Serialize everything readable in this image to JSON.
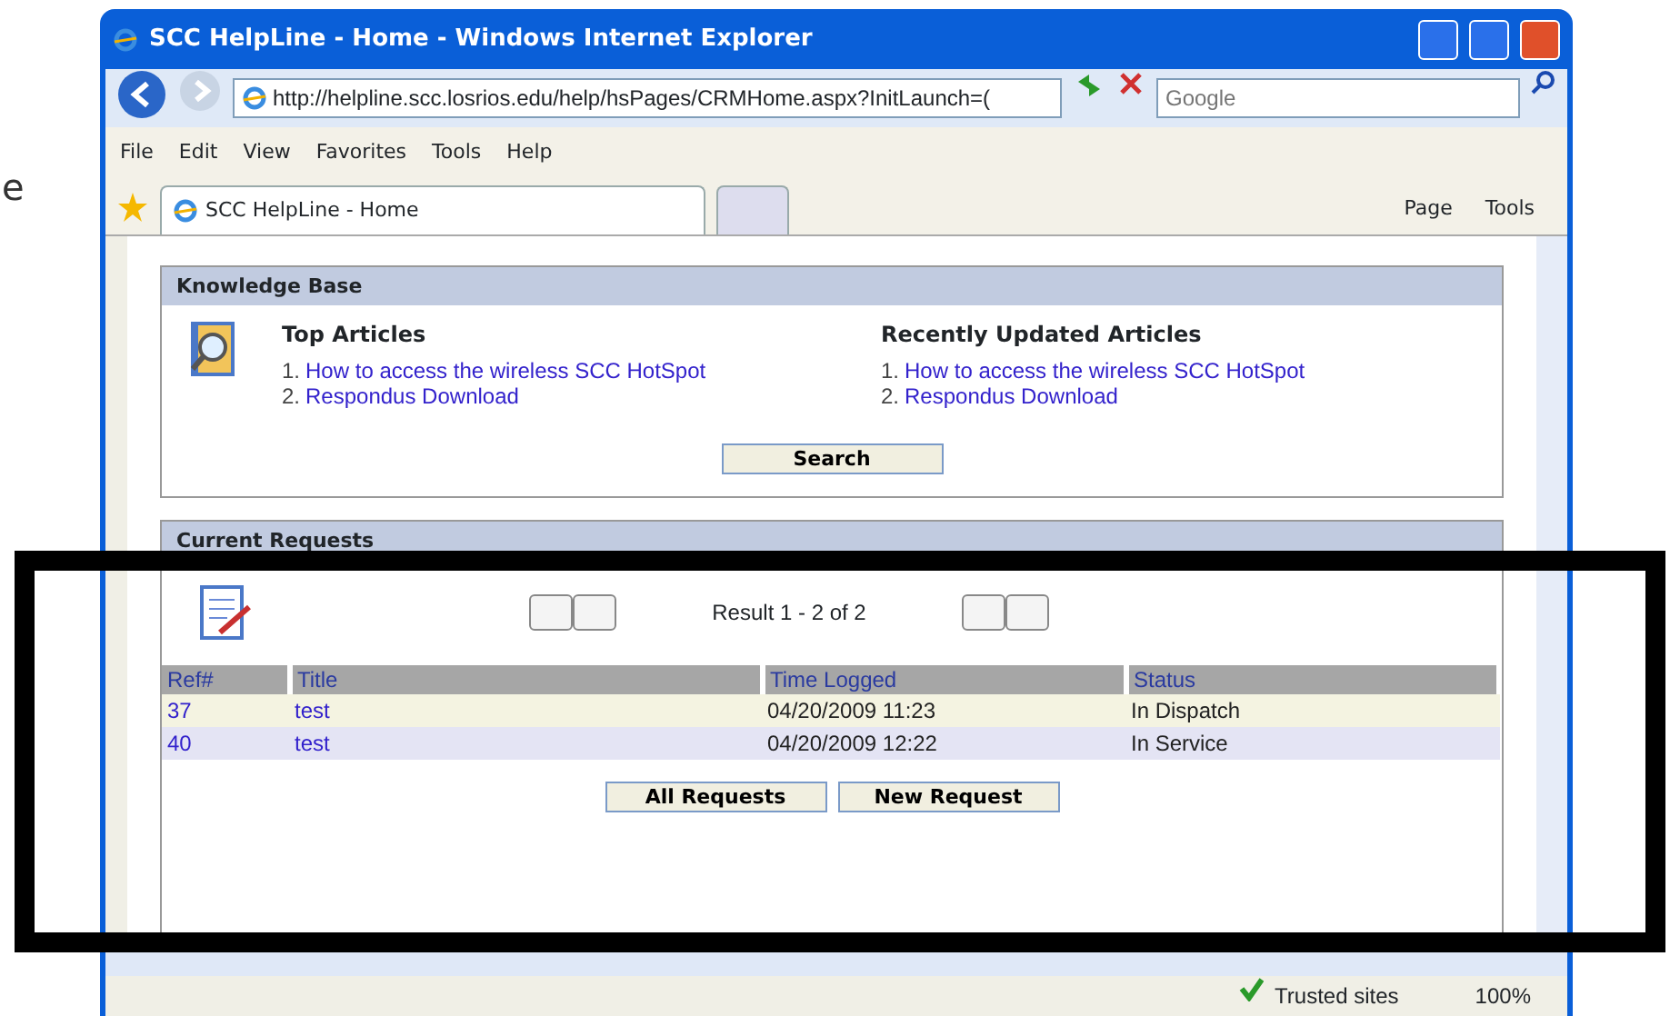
{
  "edge_text": "e",
  "window": {
    "title": "SCC HelpLine - Home - Windows Internet Explorer"
  },
  "address_bar": {
    "url": "http://helpline.scc.losrios.edu/help/hsPages/CRMHome.aspx?InitLaunch=("
  },
  "search": {
    "placeholder": "Google"
  },
  "menu": [
    "File",
    "Edit",
    "View",
    "Favorites",
    "Tools",
    "Help"
  ],
  "tabs": [
    {
      "label": "SCC HelpLine - Home",
      "selected": true
    }
  ],
  "command_bar": [
    "Page",
    "Tools"
  ],
  "knowledge_base": {
    "title": "Knowledge Base",
    "button": "Search",
    "lists": [
      {
        "heading": "Top Articles",
        "articles": [
          {
            "number": "1.",
            "title": "How to access the wireless SCC HotSpot"
          },
          {
            "number": "2.",
            "title": "Respondus Download"
          }
        ]
      },
      {
        "heading": "Recently Updated Articles",
        "articles": [
          {
            "number": "1.",
            "title": "How to access the wireless SCC HotSpot"
          },
          {
            "number": "2.",
            "title": "Respondus Download"
          }
        ]
      }
    ]
  },
  "current_requests": {
    "title": "Current Requests",
    "result": "Result 1 - 2 of 2",
    "columns": [
      "Ref#",
      "Title",
      "Time Logged",
      "Status"
    ],
    "rows": [
      {
        "ref": "37",
        "title": "test",
        "time_logged": "04/20/2009 11:23",
        "status": "In Dispatch"
      },
      {
        "ref": "40",
        "title": "test",
        "time_logged": "04/20/2009 12:22",
        "status": "In Service"
      }
    ],
    "buttons": [
      "All Requests",
      "New Request"
    ]
  },
  "status_bar": {
    "zone": "Trusted sites",
    "zoom": "100%"
  },
  "highlight_frame": true
}
